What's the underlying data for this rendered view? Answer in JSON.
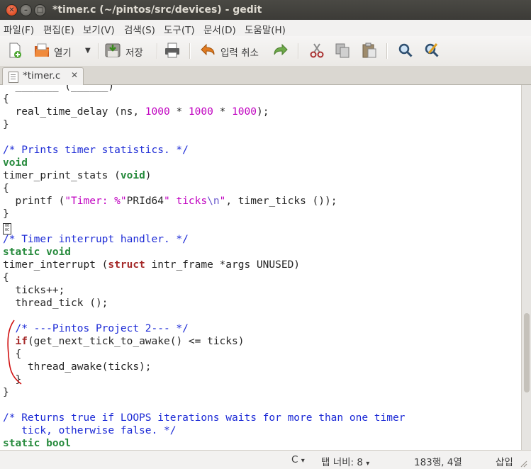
{
  "window": {
    "title": "*timer.c (~/pintos/src/devices) - gedit",
    "close_glyph": "✕",
    "min_glyph": "–",
    "max_glyph": "□"
  },
  "menubar": {
    "items": [
      "파일(F)",
      "편집(E)",
      "보기(V)",
      "검색(S)",
      "도구(T)",
      "문서(D)",
      "도움말(H)"
    ]
  },
  "toolbar": {
    "open_label": "열기",
    "save_label": "저장",
    "undo_label": "입력 취소"
  },
  "tab": {
    "label": "*timer.c",
    "close_glyph": "✕"
  },
  "editor": {
    "lines": [
      "  real_time_delay (ns, 1000 * 1000 * 1000);",
      "/* Prints timer statistics. */",
      "void",
      "timer_print_stats (void)",
      "  printf (\"Timer: %\"PRId64\" ticks\\n\", timer_ticks ());",
      "/* Timer interrupt handler. */",
      "static void",
      "timer_interrupt (struct intr_frame *args UNUSED)",
      "  ticks++;",
      "  thread_tick ();",
      "  /* ---Pintos Project 2--- */",
      "  if(get_next_tick_to_awake() <= ticks)",
      "    thread_awake(ticks);",
      "/* Returns true if LOOPS iterations waits for more than one timer",
      "   tick, otherwise false. */",
      "static bool"
    ],
    "glyph_box_text": "0008 000C"
  },
  "statusbar": {
    "language": "C",
    "tab_width": "탭 너비: 8",
    "position": "183행, 4열",
    "mode": "삽입",
    "dropdown_glyph": "▾"
  },
  "colors": {
    "comment": "#1d2bd6",
    "keyword": "#268a3c",
    "struct_keyword": "#a52a2a",
    "number_string": "#c000c0",
    "annotation": "#d01010"
  },
  "icons": [
    "new-document-icon",
    "open-folder-icon",
    "save-icon",
    "print-icon",
    "undo-icon",
    "redo-icon",
    "cut-icon",
    "copy-icon",
    "paste-icon",
    "find-icon",
    "replace-icon",
    "document-icon"
  ]
}
